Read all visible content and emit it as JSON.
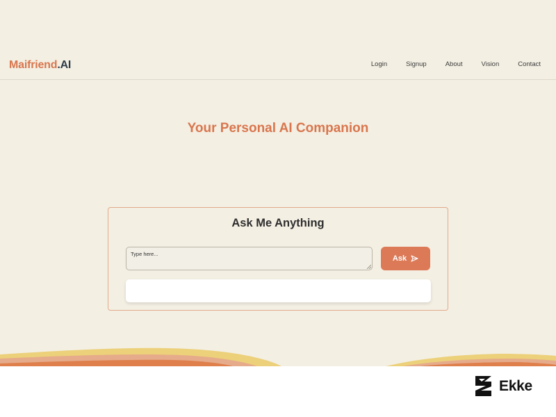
{
  "header": {
    "logo_brand": "Maifriend",
    "logo_suffix": ".AI",
    "nav": [
      "Login",
      "Signup",
      "About",
      "Vision",
      "Contact"
    ]
  },
  "hero": {
    "title": "Your Personal AI Companion"
  },
  "ask_card": {
    "heading": "Ask Me Anything",
    "input_placeholder": "Type here...",
    "input_value": "",
    "button_label": "Ask",
    "response_text": ""
  },
  "footer": {
    "badge_text": "Ekke"
  },
  "colors": {
    "accent": "#d9764d",
    "logo_dark": "#2f3d4a",
    "background": "#f3efe3",
    "button": "#dc7a58",
    "wave_yellow": "#ecd07a",
    "wave_peach": "#e6ab8a",
    "wave_orange": "#de7f4c"
  },
  "icons": {
    "send": "send-icon",
    "brand_mark": "ekke-logo-icon"
  }
}
